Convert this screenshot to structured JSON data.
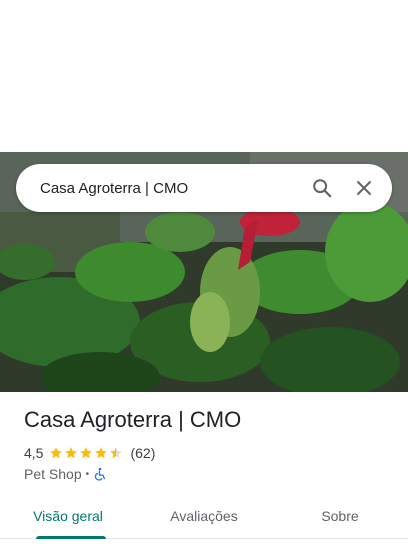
{
  "search": {
    "query": "Casa Agroterra | CMO",
    "search_icon": "search-icon",
    "close_icon": "close-icon"
  },
  "photo": {
    "icon": "place-photo"
  },
  "place": {
    "title": "Casa Agroterra | CMO",
    "rating": "4,5",
    "rating_value": 4.5,
    "reviews": "(62)",
    "category": "Pet Shop",
    "separator": "•",
    "accessibility_icon": "wheelchair-icon"
  },
  "tabs": [
    {
      "label": "Visão geral",
      "active": true
    },
    {
      "label": "Avaliações",
      "active": false
    },
    {
      "label": "Sobre",
      "active": false
    }
  ],
  "colors": {
    "accent": "#00796b",
    "star": "#fbbc04",
    "wheelchair": "#1a73e8"
  }
}
